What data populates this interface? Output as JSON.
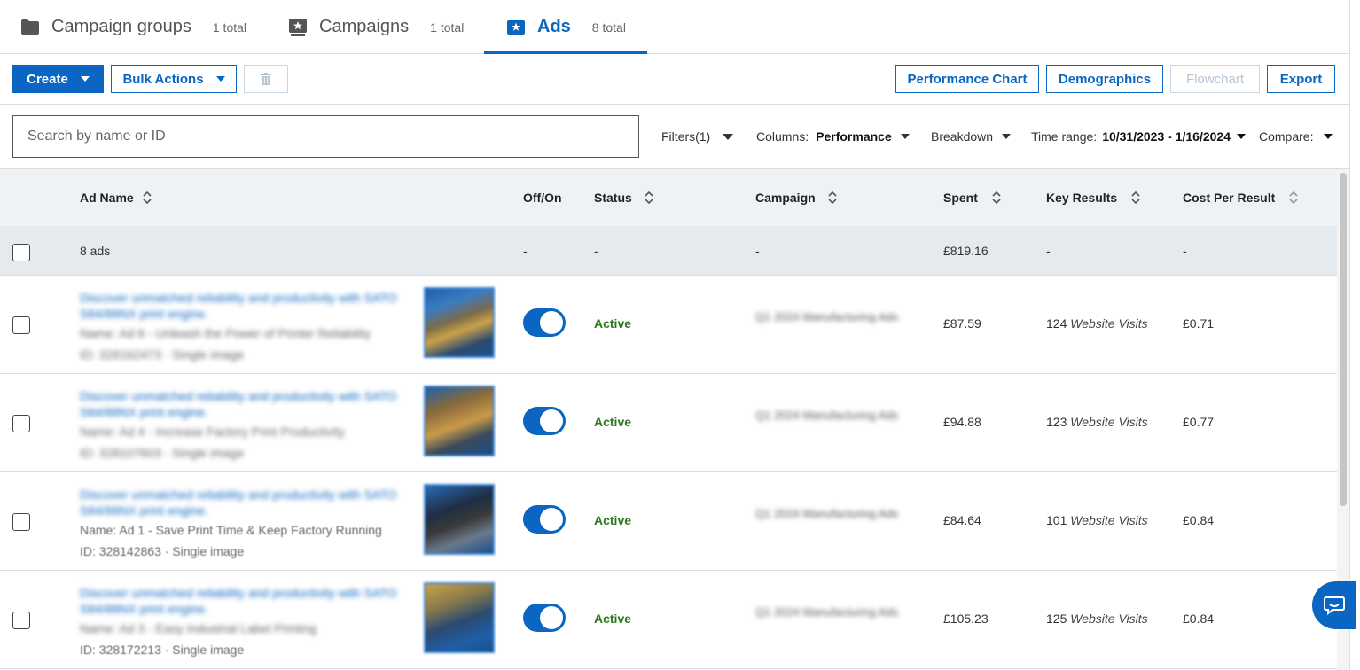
{
  "tabs": [
    {
      "label": "Campaign groups",
      "count": "1 total",
      "icon": "folder-icon"
    },
    {
      "label": "Campaigns",
      "count": "1 total",
      "icon": "campaign-icon"
    },
    {
      "label": "Ads",
      "count": "8 total",
      "icon": "ad-icon",
      "active": true
    }
  ],
  "toolbar": {
    "create": "Create",
    "bulk_actions": "Bulk Actions",
    "performance_chart": "Performance Chart",
    "demographics": "Demographics",
    "flowchart": "Flowchart",
    "export": "Export"
  },
  "filters": {
    "search_placeholder": "Search by name or ID",
    "filters_label": "Filters(1)",
    "columns_label": "Columns:",
    "columns_value": "Performance",
    "breakdown_label": "Breakdown",
    "time_range_label": "Time range:",
    "time_range_value": "10/31/2023 - 1/16/2024",
    "compare_label": "Compare:"
  },
  "table": {
    "headers": {
      "ad_name": "Ad Name",
      "off_on": "Off/On",
      "status": "Status",
      "campaign": "Campaign",
      "spent": "Spent",
      "key_results": "Key Results",
      "cost_per_result": "Cost Per Result"
    },
    "summary": {
      "ads": "8 ads",
      "off_on": "-",
      "status": "-",
      "campaign": "-",
      "spent": "£819.16",
      "key_results": "-",
      "cost_per_result": "-"
    },
    "rows": [
      {
        "title": "Discover unmatched reliability and productivity with SATO S84/88NX print engine.",
        "name": "Name: Ad 6 - Unleash the Power of Printer Reliability",
        "id": "ID: 328162473 · Single image",
        "status": "Active",
        "campaign": "Q1 2024 Manufacturing Ads",
        "spent": "£87.59",
        "results_count": "124",
        "results_type": "Website Visits",
        "cpr": "£0.71"
      },
      {
        "title": "Discover unmatched reliability and productivity with SATO S84/88NX print engine.",
        "name": "Name: Ad 4 - Increase Factory Print Productivity",
        "id": "ID: 328107603 · Single image",
        "status": "Active",
        "campaign": "Q1 2024 Manufacturing Ads",
        "spent": "£94.88",
        "results_count": "123",
        "results_type": "Website Visits",
        "cpr": "£0.77"
      },
      {
        "title": "Discover unmatched reliability and productivity with SATO S84/88NX print engine.",
        "name": "Name: Ad 1 - Save Print Time & Keep Factory Running",
        "id": "ID: 328142863 · Single image",
        "status": "Active",
        "campaign": "Q1 2024 Manufacturing Ads",
        "spent": "£84.64",
        "results_count": "101",
        "results_type": "Website Visits",
        "cpr": "£0.84"
      },
      {
        "title": "Discover unmatched reliability and productivity with SATO S84/88NX print engine.",
        "name": "Name: Ad 3 - Easy Industrial Label Printing",
        "id": "ID: 328172213 · Single image",
        "status": "Active",
        "campaign": "Q1 2024 Manufacturing Ads",
        "spent": "£105.23",
        "results_count": "125",
        "results_type": "Website Visits",
        "cpr": "£0.84"
      }
    ]
  },
  "colors": {
    "accent": "#0a66c2",
    "active_status": "#2d7a1d"
  }
}
